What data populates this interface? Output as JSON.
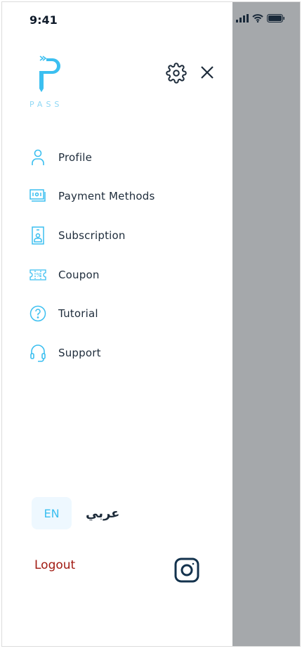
{
  "status_bar": {
    "time": "9:41"
  },
  "header": {
    "logo_text": "PASS",
    "settings_icon": "gear-icon",
    "close_icon": "close-icon"
  },
  "menu": {
    "items": [
      {
        "label": "Profile",
        "icon": "user-icon"
      },
      {
        "label": "Payment Methods",
        "icon": "cash-icon"
      },
      {
        "label": "Subscription",
        "icon": "id-badge-icon"
      },
      {
        "label": "Coupon",
        "icon": "coupon-icon"
      },
      {
        "label": "Tutorial",
        "icon": "help-circle-icon"
      },
      {
        "label": "Support",
        "icon": "headset-icon"
      }
    ]
  },
  "language": {
    "selected": "EN",
    "options": [
      "EN",
      "عربي"
    ]
  },
  "footer": {
    "logout": "Logout",
    "social_icon": "instagram-icon"
  },
  "colors": {
    "accent": "#3bbff0",
    "text": "#1d2b3a",
    "logout": "#a11a12",
    "overlay": "#a5a8ab",
    "lang_bg": "#eef8ff"
  }
}
